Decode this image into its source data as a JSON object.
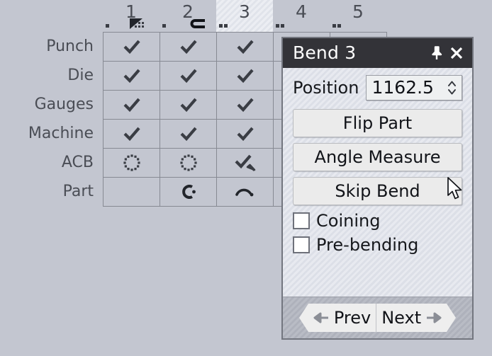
{
  "table": {
    "columns": [
      {
        "number": "1",
        "glyph": "triangle-dither-icon",
        "selected": false
      },
      {
        "number": "2",
        "glyph": "clamp-hook-icon",
        "selected": false
      },
      {
        "number": "3",
        "glyph": "dots-icon",
        "selected": true
      },
      {
        "number": "4",
        "glyph": "dots-icon",
        "selected": false
      },
      {
        "number": "5",
        "glyph": "dots-icon",
        "selected": false
      }
    ],
    "rows": [
      {
        "label": "Punch",
        "cells": [
          "check",
          "check",
          "check",
          "empty",
          "empty"
        ]
      },
      {
        "label": "Die",
        "cells": [
          "check",
          "check",
          "check",
          "empty",
          "empty"
        ]
      },
      {
        "label": "Gauges",
        "cells": [
          "check",
          "check",
          "check",
          "empty",
          "empty"
        ]
      },
      {
        "label": "Machine",
        "cells": [
          "check",
          "check",
          "check",
          "empty",
          "empty"
        ]
      },
      {
        "label": "ACB",
        "cells": [
          "pending",
          "pending",
          "check-cursor",
          "empty",
          "empty"
        ]
      },
      {
        "label": "Part",
        "cells": [
          "empty",
          "part-c",
          "part-bend",
          "empty",
          "empty"
        ]
      }
    ]
  },
  "dialog": {
    "title": "Bend 3",
    "pin_icon": "pin-icon",
    "close_icon": "close-icon",
    "position": {
      "label": "Position",
      "value": "1162.5",
      "spinner_icon": "spinner-updown-icon"
    },
    "buttons": [
      {
        "label": "Flip Part",
        "name": "flip-part-button"
      },
      {
        "label": "Angle Measure",
        "name": "angle-measure-button"
      },
      {
        "label": "Skip Bend",
        "name": "skip-bend-button"
      }
    ],
    "checkboxes": [
      {
        "label": "Coining",
        "checked": false,
        "name": "coining-checkbox"
      },
      {
        "label": "Pre-bending",
        "checked": false,
        "name": "pre-bending-checkbox"
      }
    ],
    "footer": {
      "prev_label": "Prev",
      "next_label": "Next",
      "prev_icon": "arrow-left-icon",
      "next_icon": "arrow-right-icon"
    }
  },
  "colors": {
    "background": "#c3c6d0",
    "titlebar": "#333338",
    "grid_line": "#878a93",
    "text": "#4a4d55",
    "dialog_text": "#16181c"
  }
}
